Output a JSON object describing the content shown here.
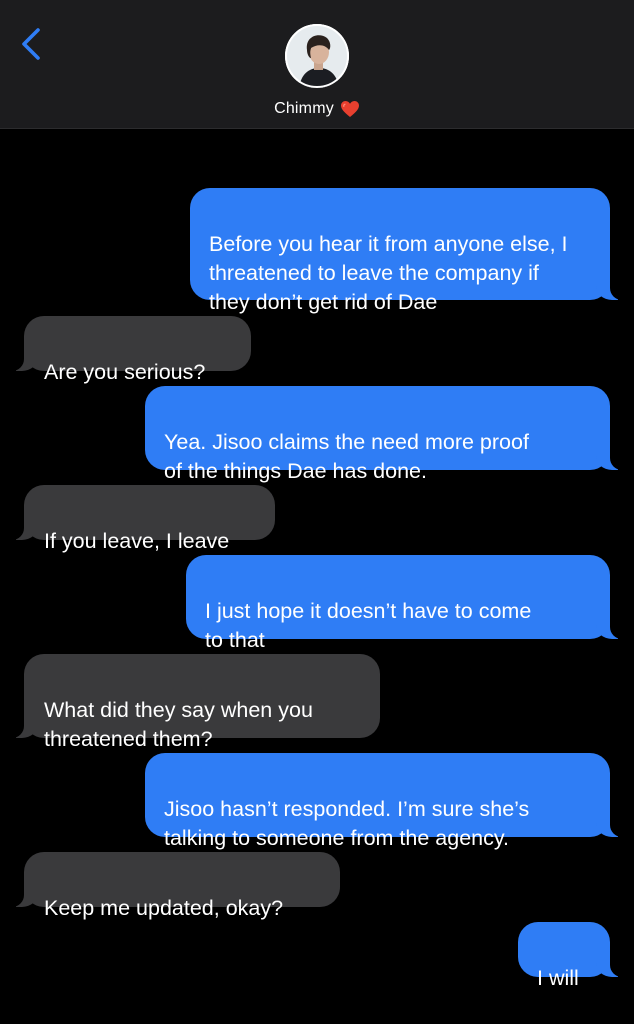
{
  "header": {
    "contact_name": "Chimmy",
    "back_icon": "chevron-left-icon",
    "heart_icon": "red-heart-icon",
    "accent_color": "#2f7df5"
  },
  "messages": [
    {
      "from": "me",
      "text": "Before you hear it from anyone else, I\nthreatened to leave the company if\nthey don’t get rid of Dae"
    },
    {
      "from": "them",
      "text": "Are you serious?"
    },
    {
      "from": "me",
      "text": "Yea. Jisoo claims the need more proof\nof the things Dae has done."
    },
    {
      "from": "them",
      "text": "If you leave, I leave"
    },
    {
      "from": "me",
      "text": "I just hope it doesn’t have to come\nto that"
    },
    {
      "from": "them",
      "text": "What did they say when you\nthreatened them?"
    },
    {
      "from": "me",
      "text": "Jisoo hasn’t responded. I’m sure she’s\ntalking to someone from the agency."
    },
    {
      "from": "them",
      "text": "Keep me updated, okay?"
    },
    {
      "from": "me",
      "text": "I will"
    }
  ],
  "colors": {
    "sent_bubble": "#2f7df5",
    "received_bubble": "#3a3a3c",
    "background": "#000000",
    "header_bg": "#1c1c1e"
  }
}
